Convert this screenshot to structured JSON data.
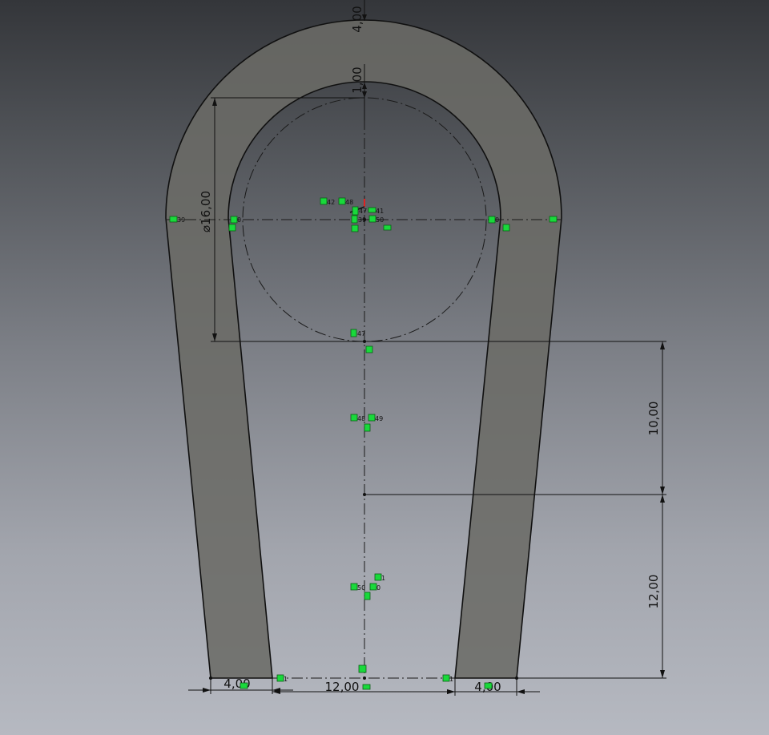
{
  "dimensions": {
    "top_wall": "4,00",
    "top_gap": "1,00",
    "diameter": "⌀16,00",
    "vertical_upper": "10,00",
    "vertical_lower": "12,00",
    "left_leg_width": "4,00",
    "gap_width": "12,00",
    "right_leg_width": "4,00"
  },
  "relation_labels": [
    "39",
    "0",
    "42",
    "48",
    "47",
    "41",
    "39",
    "50",
    "0",
    "47",
    "48",
    "49",
    "1",
    "50",
    "0",
    "1",
    "1"
  ],
  "colors": {
    "background_top": "#34363a",
    "background_bottom": "#b6b9c1",
    "part_fill": "#6b6b66",
    "edge": "#101010",
    "relation_icon": "#19d93b",
    "origin_marker": "#e02020"
  },
  "icons": [
    "coincident-relation-icon",
    "tangent-relation-icon",
    "vertical-relation-icon",
    "horizontal-relation-icon",
    "origin-marker-icon"
  ]
}
